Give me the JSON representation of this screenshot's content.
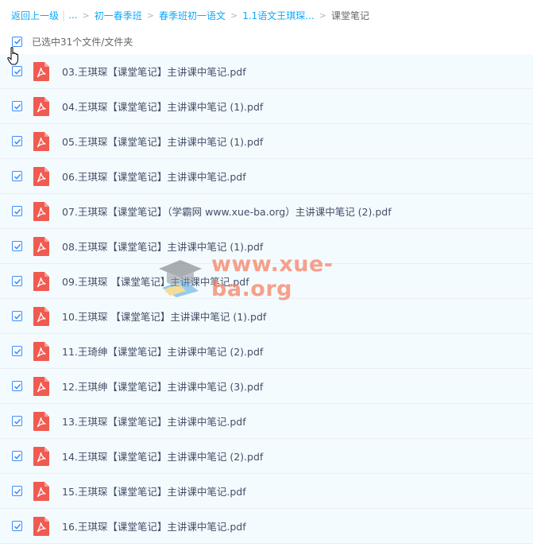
{
  "breadcrumb": {
    "back": "返回上一级",
    "bar": "|",
    "ellipsis": "...",
    "items": [
      "初一春季班",
      "春季班初一语文",
      "1.1语文王琪琛..."
    ],
    "current": "课堂笔记",
    "sep": ">"
  },
  "selection": {
    "text": "已选中31个文件/文件夹",
    "checked": true
  },
  "files": [
    {
      "name": "03.王琪琛【课堂笔记】主讲课中笔记.pdf",
      "checked": true
    },
    {
      "name": "04.王琪琛【课堂笔记】主讲课中笔记 (1).pdf",
      "checked": true
    },
    {
      "name": "05.王琪琛【课堂笔记】主讲课中笔记 (1).pdf",
      "checked": true
    },
    {
      "name": "06.王琪琛【课堂笔记】主讲课中笔记.pdf",
      "checked": true
    },
    {
      "name": "07.王琪琛【课堂笔记】（学霸网 www.xue-ba.org）主讲课中笔记 (2).pdf",
      "checked": true
    },
    {
      "name": "08.王琪琛【课堂笔记】主讲课中笔记 (1).pdf",
      "checked": true
    },
    {
      "name": "09.王琪琛 【课堂笔记】主讲课中笔记.pdf",
      "checked": true
    },
    {
      "name": "10.王琪琛 【课堂笔记】主讲课中笔记 (1).pdf",
      "checked": true
    },
    {
      "name": "11.王琦绅【课堂笔记】主讲课中笔记 (2).pdf",
      "checked": true
    },
    {
      "name": "12.王琪绅【课堂笔记】主讲课中笔记 (3).pdf",
      "checked": true
    },
    {
      "name": "13.王琪琛【课堂笔记】主讲课中笔记.pdf",
      "checked": true
    },
    {
      "name": "14.王琪琛【课堂笔记】主讲课中笔记 (2).pdf",
      "checked": true
    },
    {
      "name": "15.王琪琛【课堂笔记】主讲课中笔记.pdf",
      "checked": true
    },
    {
      "name": "16.王琪琛【课堂笔记】主讲课中笔记.pdf",
      "checked": true
    }
  ],
  "watermark": {
    "text": "www.xue-ba.org"
  },
  "icons": {
    "file": "pdf-file-icon",
    "check": "checkmark-icon",
    "cursor": "hand-pointer-icon"
  },
  "colors": {
    "accent": "#09aaff",
    "row_bg": "#f4fbff",
    "pdf_red": "#f15a50",
    "check": "#3b8cff"
  }
}
